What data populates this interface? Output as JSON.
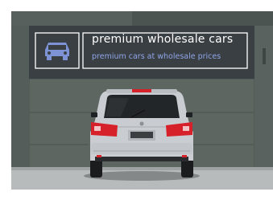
{
  "sign": {
    "title": "premium wholesale cars",
    "subtitle": "premium cars at wholesale prices",
    "logo_icon": "car-front-icon"
  },
  "colors": {
    "sign_background": "#3a3f44",
    "sign_text": "#ffffff",
    "sign_subtext": "#8fa6e8",
    "logo_accent": "#7e93d6",
    "car_body": "#c9ccd0",
    "taillight": "#d6202a",
    "wall": "#5d6660"
  }
}
